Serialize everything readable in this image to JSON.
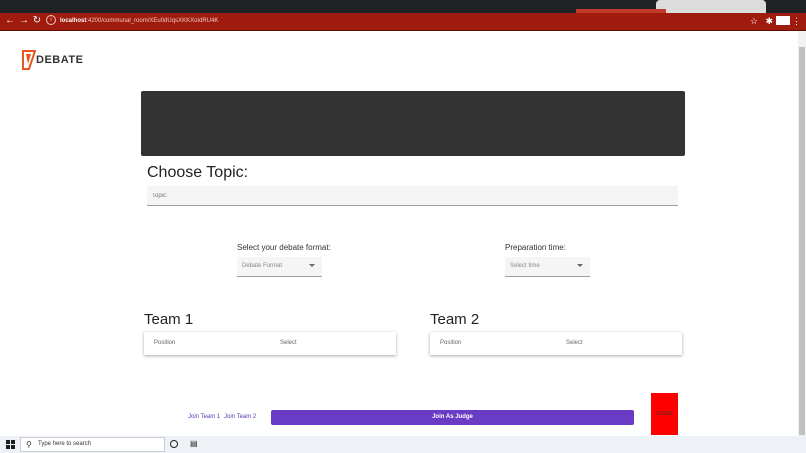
{
  "browser": {
    "url_host": "localhost",
    "url_rest": ":4200/communal_room/XEu0dUqsXKKXoIdRU4K",
    "back_icon": "arrow-left-icon",
    "forward_icon": "arrow-right-icon",
    "reload_icon": "reload-icon"
  },
  "logo": {
    "text": "DEBATE"
  },
  "topic": {
    "title": "Choose Topic:",
    "placeholder": "Topic:"
  },
  "format": {
    "label": "Select your debate format:",
    "value": "Debate Format"
  },
  "prep": {
    "label": "Preparation time:",
    "value": "Select time"
  },
  "teams": [
    {
      "title": "Team 1",
      "col1": "Position",
      "col2": "Select"
    },
    {
      "title": "Team 2",
      "col1": "Position",
      "col2": "Select"
    }
  ],
  "actions": {
    "join_team1": "Join Team 1",
    "join_team2": "Join Team 2",
    "join_judge": "Join As Judge",
    "close": "CLOSE"
  },
  "taskbar": {
    "search_placeholder": "Type here to search"
  },
  "colors": {
    "toolbar": "#9e1b0e",
    "banner": "#333333",
    "accent_purple": "#6a3cc6",
    "close_red": "#ff0000"
  }
}
